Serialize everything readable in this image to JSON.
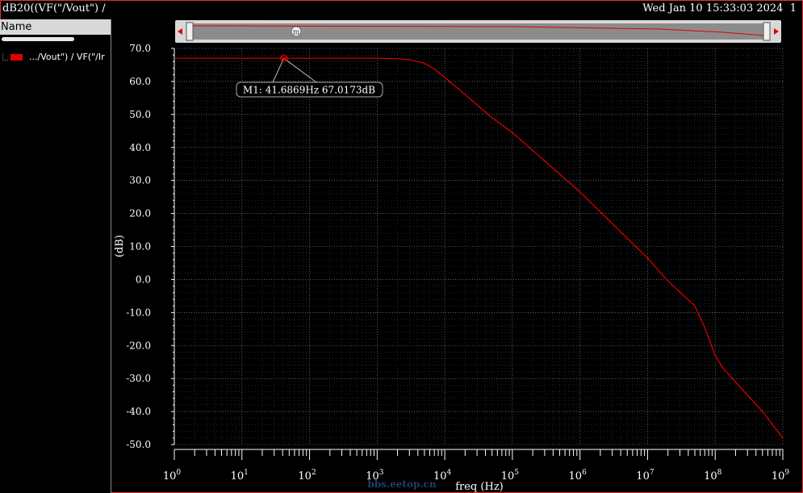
{
  "window": {
    "title": "dB20((VF(\"/Vout\") /",
    "datetime": "Wed Jan 10 15:33:03 2024",
    "page_number": "1"
  },
  "legend": {
    "header": "Name",
    "items": [
      {
        "label": ".../Vout\") / VF(\"/Ir",
        "color": "#e00000"
      }
    ]
  },
  "marker": {
    "id": "m",
    "label": "M1: 41.6869Hz 67.0173dB",
    "x": 41.6869,
    "y": 67.0173
  },
  "watermark": "bbs.eetop.cn",
  "colors": {
    "trace": "#e00000",
    "grid": "#9a9a9a",
    "axis": "#ffffff",
    "border": "#dd3333"
  },
  "chart_data": {
    "type": "line",
    "xscale": "log",
    "xlim": [
      1,
      1000000000
    ],
    "ylim": [
      -50,
      70
    ],
    "xlabel": "freq (Hz)",
    "ylabel": "(dB)",
    "grid": true,
    "yticks": [
      {
        "value": 70,
        "label": "70.0"
      },
      {
        "value": 60,
        "label": "60.0"
      },
      {
        "value": 50,
        "label": "50.0"
      },
      {
        "value": 40,
        "label": "40.0"
      },
      {
        "value": 30,
        "label": "30.0"
      },
      {
        "value": 20,
        "label": "20.0"
      },
      {
        "value": 10,
        "label": "10.0"
      },
      {
        "value": 0,
        "label": "0.0"
      },
      {
        "value": -10,
        "label": "-10.0"
      },
      {
        "value": -20,
        "label": "-20.0"
      },
      {
        "value": -30,
        "label": "-30.0"
      },
      {
        "value": -40,
        "label": "-40.0"
      },
      {
        "value": -50,
        "label": "-50.0"
      }
    ],
    "xticks": [
      {
        "value": 1,
        "base": "10",
        "exp": "0"
      },
      {
        "value": 10,
        "base": "10",
        "exp": "1"
      },
      {
        "value": 100,
        "base": "10",
        "exp": "2"
      },
      {
        "value": 1000,
        "base": "10",
        "exp": "3"
      },
      {
        "value": 10000,
        "base": "10",
        "exp": "4"
      },
      {
        "value": 100000,
        "base": "10",
        "exp": "5"
      },
      {
        "value": 1000000,
        "base": "10",
        "exp": "6"
      },
      {
        "value": 10000000,
        "base": "10",
        "exp": "7"
      },
      {
        "value": 100000000,
        "base": "10",
        "exp": "8"
      },
      {
        "value": 1000000000,
        "base": "10",
        "exp": "9"
      }
    ],
    "series": [
      {
        "x": [
          1,
          10,
          100,
          1000,
          2000,
          3000,
          5000,
          7000,
          10000,
          20000,
          50000,
          100000,
          1000000,
          5000000,
          10000000,
          20000000,
          50000000,
          70000000,
          100000000,
          130000000,
          200000000,
          500000000,
          1000000000
        ],
        "y": [
          67.02,
          67.02,
          67.02,
          67.02,
          66.9,
          66.6,
          65.5,
          63.8,
          61.2,
          56.0,
          49.0,
          44.5,
          26.5,
          12.5,
          6.5,
          -0.5,
          -8.0,
          -14.5,
          -23.0,
          -26.8,
          -31.0,
          -40.0,
          -48.0
        ]
      }
    ]
  }
}
